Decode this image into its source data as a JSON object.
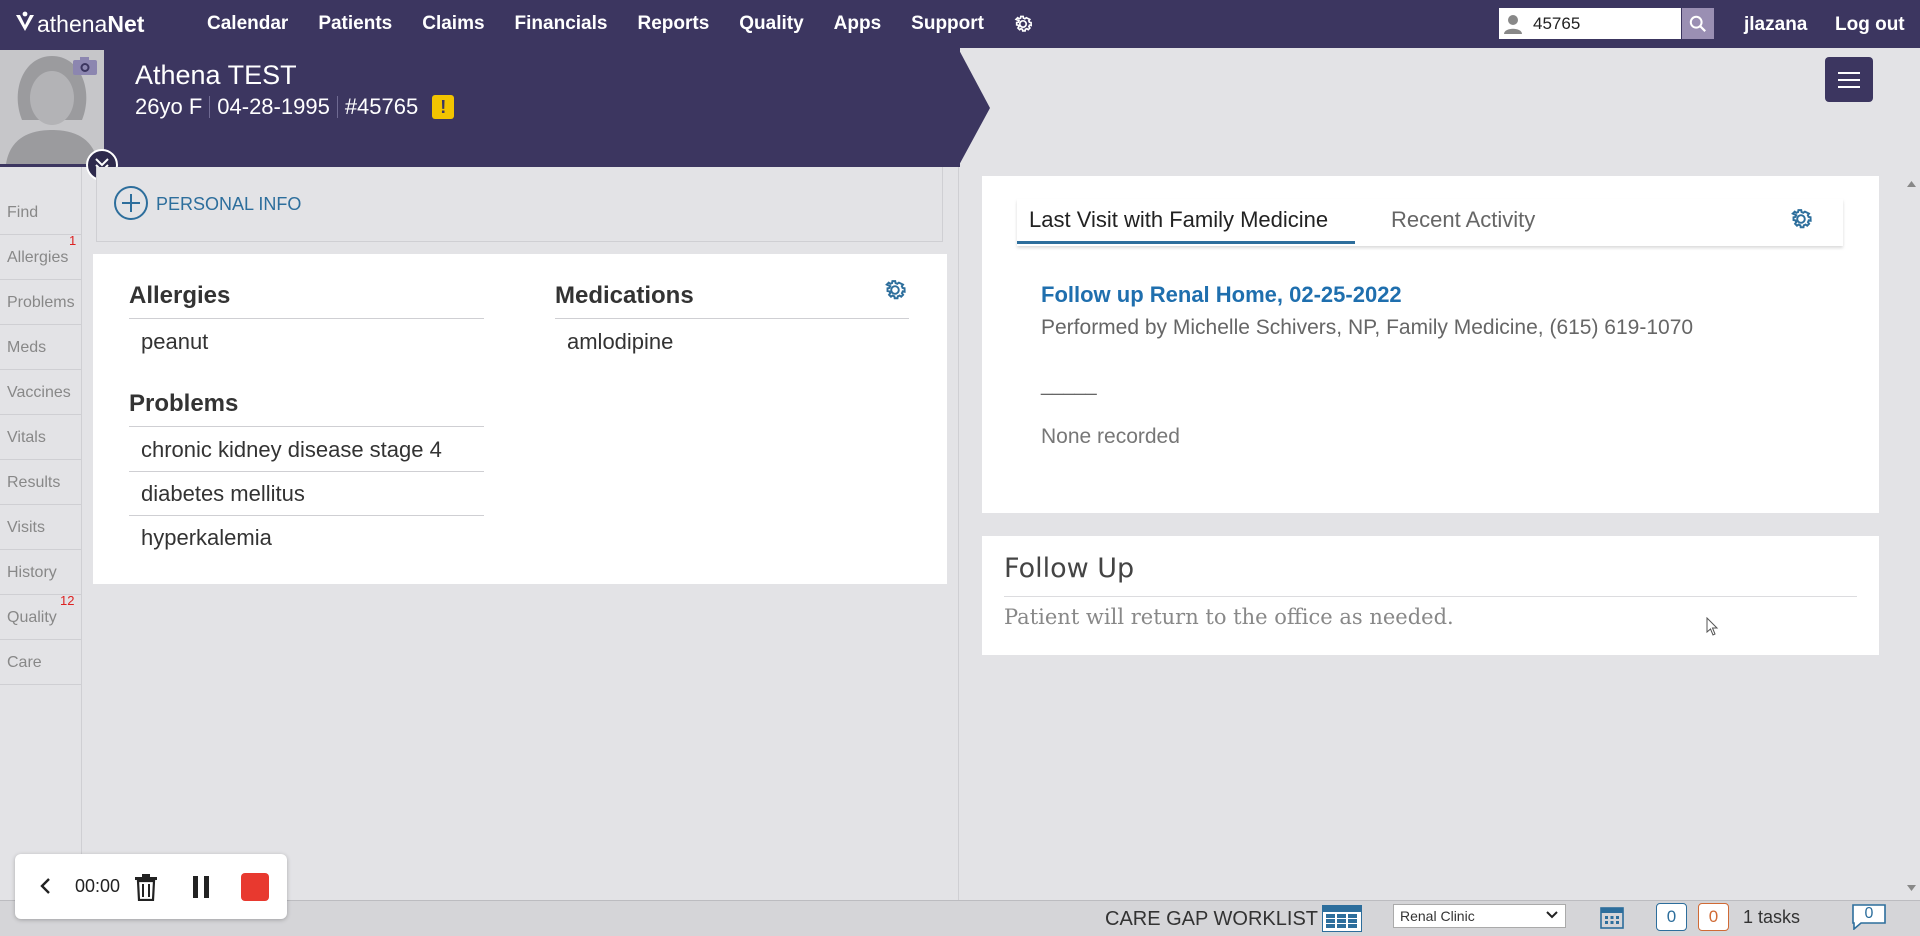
{
  "nav": {
    "logo_prefix": "athena",
    "logo_suffix": "Net",
    "items": [
      "Calendar",
      "Patients",
      "Claims",
      "Financials",
      "Reports",
      "Quality",
      "Apps",
      "Support"
    ],
    "search_value": "45765",
    "username": "jlazana",
    "logout": "Log out"
  },
  "patient": {
    "name": "Athena TEST",
    "age_sex": "26yo F",
    "dob": "04-28-1995",
    "id": "#45765",
    "alert": "!"
  },
  "sidebar": {
    "items": [
      {
        "label": "Find",
        "count": ""
      },
      {
        "label": "Allergies",
        "count": "1"
      },
      {
        "label": "Problems",
        "count": ""
      },
      {
        "label": "Meds",
        "count": ""
      },
      {
        "label": "Vaccines",
        "count": ""
      },
      {
        "label": "Vitals",
        "count": ""
      },
      {
        "label": "Results",
        "count": ""
      },
      {
        "label": "Visits",
        "count": ""
      },
      {
        "label": "History",
        "count": ""
      },
      {
        "label": "Quality",
        "count": "12"
      },
      {
        "label": "Care",
        "count": ""
      }
    ]
  },
  "personal_info": {
    "label": "PERSONAL INFO"
  },
  "summary": {
    "allergies_title": "Allergies",
    "allergies": [
      "peanut"
    ],
    "medications_title": "Medications",
    "medications": [
      "amlodipine"
    ],
    "problems_title": "Problems",
    "problems": [
      "chronic kidney disease stage 4",
      "diabetes mellitus",
      "hyperkalemia"
    ]
  },
  "visit": {
    "tabs": [
      "Last Visit with Family Medicine",
      "Recent Activity"
    ],
    "link": "Follow up Renal Home, 02-25-2022",
    "performed_by": "Performed by Michelle Schivers, NP, Family Medicine, (615) 619-1070",
    "blank": "_____",
    "none": "None recorded"
  },
  "follow_up": {
    "title": "Follow Up",
    "text": "Patient will return to the office as needed."
  },
  "bottom": {
    "care_gap": "CARE GAP WORKLIST",
    "department": "Renal Clinic",
    "count_blue": "0",
    "count_orange": "0",
    "tasks": "1 tasks",
    "messages": "0"
  },
  "recorder": {
    "time": "00:00"
  },
  "colors": {
    "nav": "#3c3660",
    "accent": "#2d6e9c",
    "link": "#1f6fae",
    "alert": "#f2c400",
    "record": "#e8392f"
  }
}
